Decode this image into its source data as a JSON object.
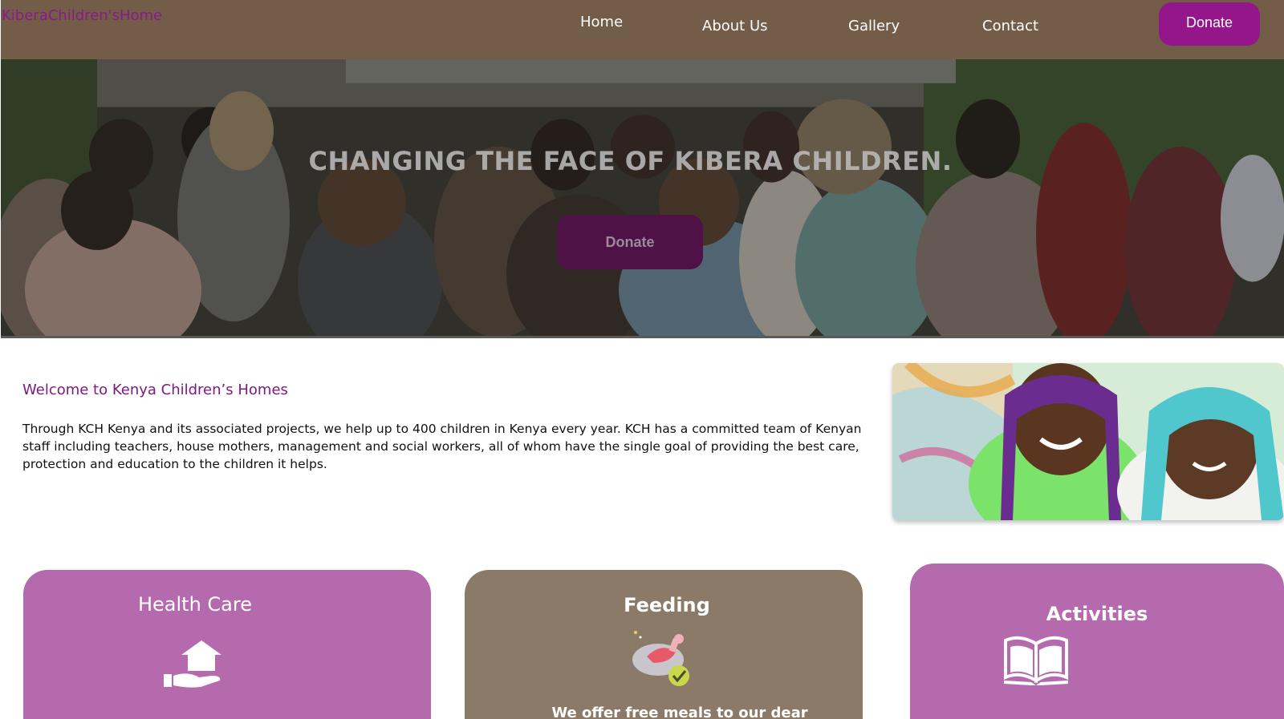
{
  "navbar": {
    "brand": "KiberaChildren'sHome",
    "links": {
      "home": "Home",
      "about": "About Us",
      "gallery": "Gallery",
      "contact": "Contact"
    },
    "donate_label": "Donate"
  },
  "hero": {
    "title": "CHANGING THE FACE OF KIBERA CHILDREN.",
    "donate_label": "Donate"
  },
  "welcome": {
    "title": "Welcome to Kenya Children’s Homes",
    "text": "Through KCH Kenya and its associated projects, we help up to 400 children in Kenya every year.  KCH has a committed team of Kenyan staff including teachers, house mothers, management and social workers, all of whom have the single goal of providing the best care, protection and education to the children it helps."
  },
  "cards": {
    "health": {
      "title": "Health Care",
      "icon": "hand-house-icon"
    },
    "feeding": {
      "title": "Feeding",
      "icon": "meal-plate-icon",
      "text": "We offer free meals to our dear"
    },
    "activities": {
      "title": "Activities",
      "icon": "open-book-icon"
    }
  },
  "colors": {
    "navbar": "#735d48",
    "brand": "#8a1a8a",
    "donate": "#93178a",
    "hero_donate": "#4e1246",
    "card_purple": "#b66aae",
    "card_brown": "#8c7a68",
    "welcome_title": "#7b1b80"
  }
}
